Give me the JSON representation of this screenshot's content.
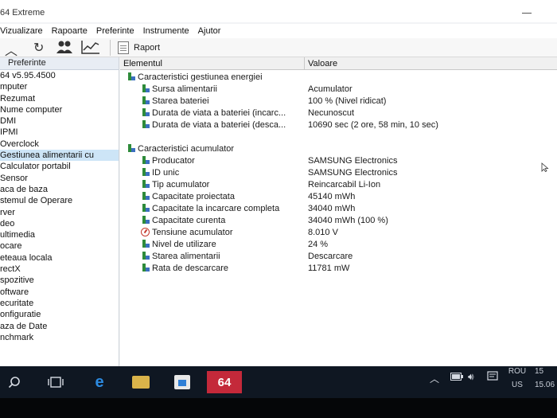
{
  "window": {
    "title": "64 Extreme"
  },
  "menu": [
    "Vizualizare",
    "Rapoarte",
    "Preferinte",
    "Instrumente",
    "Ajutor"
  ],
  "toolbar": {
    "report_label": "Raport"
  },
  "left_panel": {
    "header": "Preferinte",
    "items": [
      "64 v5.95.4500",
      "mputer",
      "Rezumat",
      "Nume computer",
      "DMI",
      "IPMI",
      "Overclock",
      "Gestiunea alimentarii cu",
      "Calculator portabil",
      "Sensor",
      "aca de baza",
      "stemul de Operare",
      "rver",
      "deo",
      "ultimedia",
      "ocare",
      "eteaua locala",
      "rectX",
      "spozitive",
      "oftware",
      "ecuritate",
      "onfiguratie",
      "aza de Date",
      "nchmark"
    ],
    "selected_index": 7
  },
  "columns": {
    "element": "Elementul",
    "value": "Valoare"
  },
  "groups": [
    {
      "title": "Caracteristici gestiunea energiei",
      "rows": [
        {
          "name": "Sursa alimentarii",
          "value": "Acumulator"
        },
        {
          "name": "Starea bateriei",
          "value": "100 % (Nivel ridicat)"
        },
        {
          "name": "Durata de viata a bateriei (incarc...",
          "value": "Necunoscut"
        },
        {
          "name": "Durata de viata a bateriei (desca...",
          "value": "10690 sec (2 ore, 58 min, 10 sec)"
        }
      ]
    },
    {
      "title": "Caracteristici acumulator",
      "rows": [
        {
          "name": "Producator",
          "value": "SAMSUNG Electronics"
        },
        {
          "name": "ID unic",
          "value": "SAMSUNG Electronics"
        },
        {
          "name": "Tip acumulator",
          "value": "Reincarcabil Li-Ion"
        },
        {
          "name": "Capacitate proiectata",
          "value": "45140 mWh"
        },
        {
          "name": "Capacitate la incarcare completa",
          "value": "34040 mWh"
        },
        {
          "name": "Capacitate curenta",
          "value": "34040 mWh  (100 %)"
        },
        {
          "name": "Tensiune acumulator",
          "value": "8.010 V",
          "icon": "gauge-icon"
        },
        {
          "name": "Nivel de utilizare",
          "value": "24 %"
        },
        {
          "name": "Starea alimentarii",
          "value": "Descarcare"
        },
        {
          "name": "Rata de descarcare",
          "value": "11781 mW"
        }
      ]
    }
  ],
  "taskbar": {
    "active_app_label": "64",
    "lang": [
      "ROU",
      "US"
    ],
    "clock": [
      "15",
      "15.06"
    ]
  }
}
